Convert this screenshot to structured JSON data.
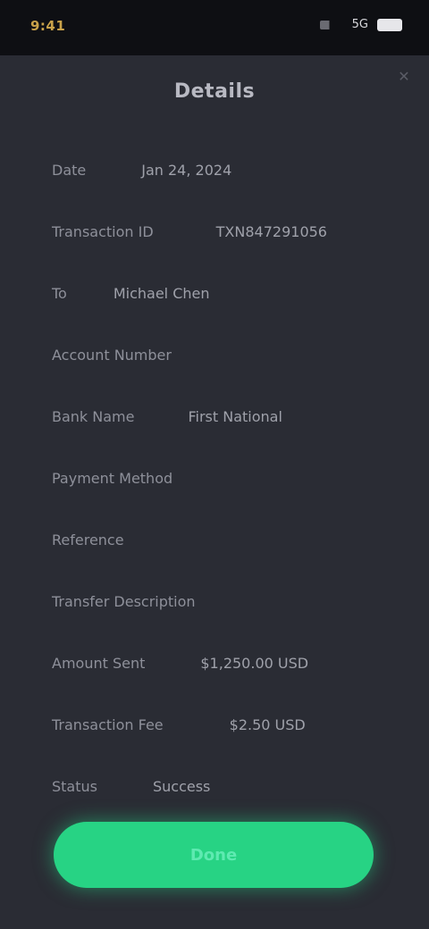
{
  "status_bar": {
    "time": "9:41",
    "network": "5G"
  },
  "title": "Details",
  "rows": [
    {
      "label": "Date",
      "value": "Jan 24, 2024",
      "gap": 62
    },
    {
      "label": "Transaction ID",
      "value": "TXN847291056",
      "gap": 70
    },
    {
      "label": "To",
      "value": "Michael Chen",
      "gap": 52
    },
    {
      "label": "Account Number",
      "value": "",
      "gap": 0
    },
    {
      "label": "Bank Name",
      "value": "First National",
      "gap": 60
    },
    {
      "label": "Payment Method",
      "value": "",
      "gap": 0
    },
    {
      "label": "Reference",
      "value": "",
      "gap": 0
    },
    {
      "label": "Transfer Description",
      "value": "",
      "gap": 0
    },
    {
      "label": "Amount Sent",
      "value": "$1,250.00 USD",
      "gap": 62
    },
    {
      "label": "Transaction Fee",
      "value": "$2.50 USD",
      "gap": 74
    },
    {
      "label": "Status",
      "value": "Success",
      "gap": 62
    }
  ],
  "actions": {
    "primary_label": "Done"
  }
}
